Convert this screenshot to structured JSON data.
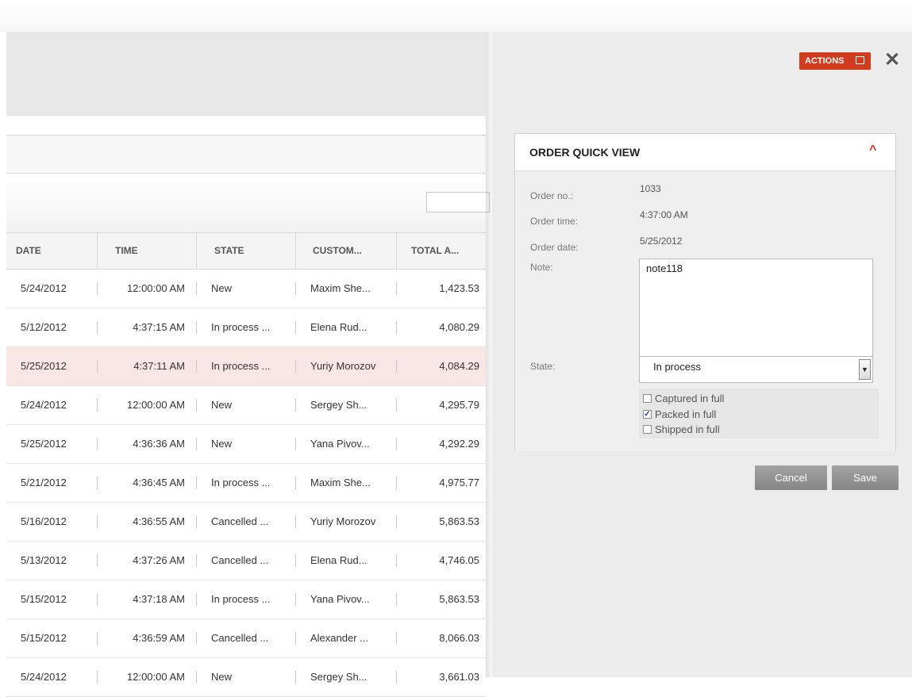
{
  "table": {
    "columns": [
      "DATE",
      "TIME",
      "STATE",
      "CUSTOM...",
      "TOTAL A..."
    ],
    "rows": [
      {
        "date": "5/24/2012",
        "time": "12:00:00 AM",
        "state": "New",
        "customer": "Maxim She...",
        "total": "1,423.53",
        "selected": false
      },
      {
        "date": "5/12/2012",
        "time": "4:37:15 AM",
        "state": "In process ...",
        "customer": "Elena Rud...",
        "total": "4,080.29",
        "selected": false
      },
      {
        "date": "5/25/2012",
        "time": "4:37:11 AM",
        "state": "In process ...",
        "customer": "Yuriy Morozov",
        "total": "4,084.29",
        "selected": true
      },
      {
        "date": "5/24/2012",
        "time": "12:00:00 AM",
        "state": "New",
        "customer": "Sergey Sh...",
        "total": "4,295.79",
        "selected": false
      },
      {
        "date": "5/25/2012",
        "time": "4:36:36 AM",
        "state": "New",
        "customer": "Yana Pivov...",
        "total": "4,292.29",
        "selected": false
      },
      {
        "date": "5/21/2012",
        "time": "4:36:45 AM",
        "state": "In process ...",
        "customer": "Maxim She...",
        "total": "4,975.77",
        "selected": false
      },
      {
        "date": "5/16/2012",
        "time": "4:36:55 AM",
        "state": "Cancelled ...",
        "customer": "Yuriy Morozov",
        "total": "5,863.53",
        "selected": false
      },
      {
        "date": "5/13/2012",
        "time": "4:37:26 AM",
        "state": "Cancelled ...",
        "customer": "Elena Rud...",
        "total": "4,746.05",
        "selected": false
      },
      {
        "date": "5/15/2012",
        "time": "4:37:18 AM",
        "state": "In process ...",
        "customer": "Yana Pivov...",
        "total": "5,863.53",
        "selected": false
      },
      {
        "date": "5/15/2012",
        "time": "4:36:59 AM",
        "state": "Cancelled ...",
        "customer": "Alexander ...",
        "total": "8,066.03",
        "selected": false
      },
      {
        "date": "5/24/2012",
        "time": "12:00:00 AM",
        "state": "New",
        "customer": "Sergey Sh...",
        "total": "3,661.03",
        "selected": false
      }
    ]
  },
  "panel": {
    "actions_label": "ACTIONS",
    "close_glyph": "✕",
    "quick_view": {
      "title": "ORDER QUICK VIEW",
      "collapse_glyph": "^",
      "order_no_label": "Order no.:",
      "order_no": "1033",
      "order_time_label": "Order time:",
      "order_time": "4:37:00 AM",
      "order_date_label": "Order date:",
      "order_date": "5/25/2012",
      "note_label": "Note:",
      "note": "note118",
      "state_label": "State:",
      "state": "In process",
      "checkboxes": [
        {
          "label": "Captured in full",
          "checked": false
        },
        {
          "label": "Packed in full",
          "checked": true
        },
        {
          "label": "Shipped in full",
          "checked": false
        }
      ]
    },
    "cancel_label": "Cancel",
    "save_label": "Save"
  },
  "colors": {
    "accent": "#d13b1e",
    "selected_row": "#f7e6e3",
    "panel_bg": "#ececec"
  }
}
